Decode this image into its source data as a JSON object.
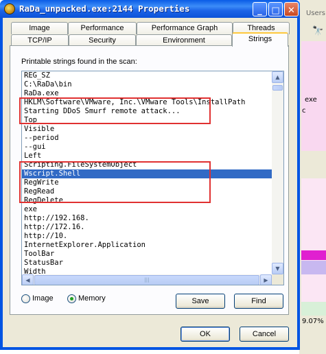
{
  "window": {
    "title": "RaDa_unpacked.exe:2144 Properties"
  },
  "title_buttons": {
    "minimize": "_",
    "maximize": "□",
    "close": "✕"
  },
  "tabs_top": [
    "Image",
    "Performance",
    "Performance Graph",
    "Threads"
  ],
  "tabs_bottom": [
    "TCP/IP",
    "Security",
    "Environment",
    "Strings"
  ],
  "active_tab": "Strings",
  "strings_panel": {
    "label": "Printable strings found in the scan:",
    "items": [
      "REG_SZ",
      "C:\\RaDa\\bin",
      "RaDa.exe",
      "HKLM\\Software\\VMware, Inc.\\VMware Tools\\InstallPath",
      "Starting DDoS Smurf remote attack...",
      "Top",
      "Visible",
      "--period",
      "--gui",
      "Left",
      "Scripting.FileSystemObject",
      "Wscript.Shell",
      "RegWrite",
      "RegRead",
      "RegDelete",
      "exe",
      "http://192.168.",
      "http://172.16.",
      "http://10.",
      "InternetExplorer.Application",
      "ToolBar",
      "StatusBar",
      "Width"
    ],
    "selected_index": 11
  },
  "scan_mode": {
    "image_label": "Image",
    "memory_label": "Memory",
    "selected": "Memory"
  },
  "buttons": {
    "save": "Save",
    "find": "Find",
    "ok": "OK",
    "cancel": "Cancel"
  },
  "background": {
    "users_label": "Users",
    "exe_label": "exe",
    "c_label": "c",
    "percent_label": "9.07%"
  },
  "colors": {
    "selection": "#316ac5",
    "highlight_box": "#e03030",
    "titlebar": "#0054e3"
  }
}
